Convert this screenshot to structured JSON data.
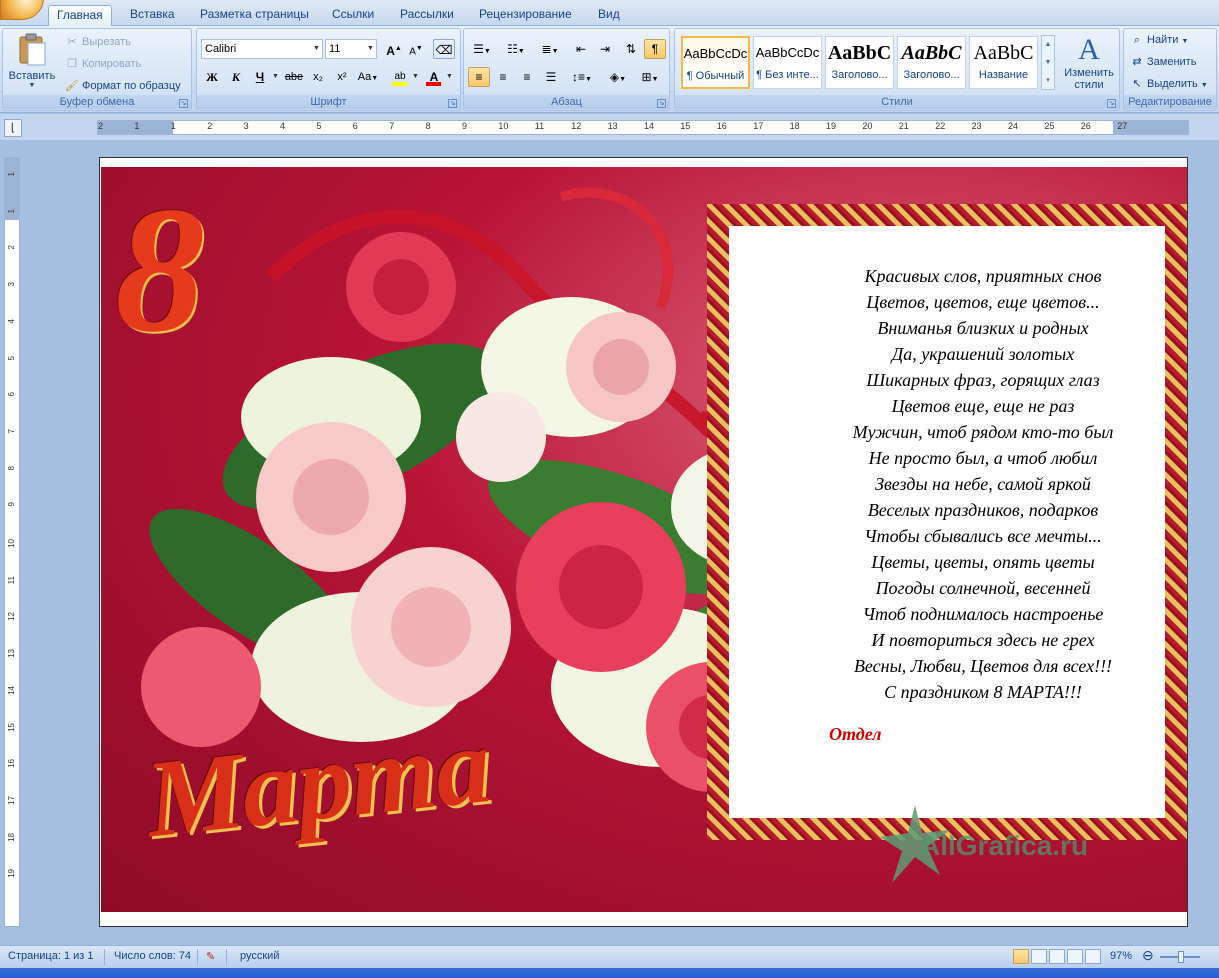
{
  "tabs": [
    "Главная",
    "Вставка",
    "Разметка страницы",
    "Ссылки",
    "Рассылки",
    "Рецензирование",
    "Вид"
  ],
  "clipboard": {
    "paste": "Вставить",
    "cut": "Вырезать",
    "copy": "Копировать",
    "format_painter": "Формат по образцу",
    "label": "Буфер обмена"
  },
  "font": {
    "name": "Calibri",
    "size": "11",
    "label": "Шрифт",
    "bold": "Ж",
    "italic": "К",
    "underline": "Ч",
    "strike": "abe",
    "subscript": "x₂",
    "superscript": "x²",
    "change_case": "Aa",
    "highlight": "ab",
    "color": "A",
    "grow": "A",
    "shrink": "A",
    "highlight_color": "#ffff00",
    "font_color": "#e60000"
  },
  "paragraph": {
    "label": "Абзац"
  },
  "styles": {
    "label": "Стили",
    "items": [
      {
        "preview": "AaBbCcDc",
        "name": "¶ Обычный"
      },
      {
        "preview": "AaBbCcDc",
        "name": "¶ Без инте..."
      },
      {
        "preview": "AaBbC",
        "name": "Заголово..."
      },
      {
        "preview": "AaBbC",
        "name": "Заголово..."
      },
      {
        "preview": "AaBbC",
        "name": "Название"
      }
    ],
    "change": "Изменить стили"
  },
  "editing": {
    "label": "Редактирование",
    "find": "Найти",
    "replace": "Заменить",
    "select": "Выделить"
  },
  "ruler": {
    "h_ticks": [
      "2",
      "1",
      "1",
      "2",
      "3",
      "4",
      "5",
      "6",
      "7",
      "8",
      "9",
      "10",
      "11",
      "12",
      "13",
      "14",
      "15",
      "16",
      "17",
      "18",
      "19",
      "20",
      "21",
      "22",
      "23",
      "24",
      "25",
      "26",
      "27"
    ],
    "v_ticks": [
      "1",
      "1",
      "2",
      "3",
      "4",
      "5",
      "6",
      "7",
      "8",
      "9",
      "10",
      "11",
      "12",
      "13",
      "14",
      "15",
      "16",
      "17",
      "18",
      "19"
    ]
  },
  "card": {
    "eight": "8",
    "marta": "Марта",
    "poem": [
      "Красивых слов, приятных снов",
      "Цветов, цветов, еще цветов...",
      "Вниманья близких и родных",
      "Да, украшений золотых",
      "Шикарных фраз, горящих глаз",
      "Цветов еще, еще не раз",
      "Мужчин, чтоб рядом кто-то был",
      "Не просто был, а чтоб любил",
      "Звезды на небе, самой яркой",
      "Веселых праздников, подарков",
      "Чтобы сбывались все мечты...",
      "Цветы, цветы, опять цветы",
      "Погоды солнечной, весенней",
      "Чтоб поднималось настроенье",
      "И повториться здесь не грех",
      "Весны, Любви, Цветов для всех!!!",
      "С праздником 8 МАРТА!!!"
    ],
    "signature": "Отдел",
    "watermark": "AllGrafica.ru"
  },
  "status": {
    "page": "Страница: 1 из 1",
    "words": "Число слов: 74",
    "language": "русский",
    "zoom": "97%"
  }
}
